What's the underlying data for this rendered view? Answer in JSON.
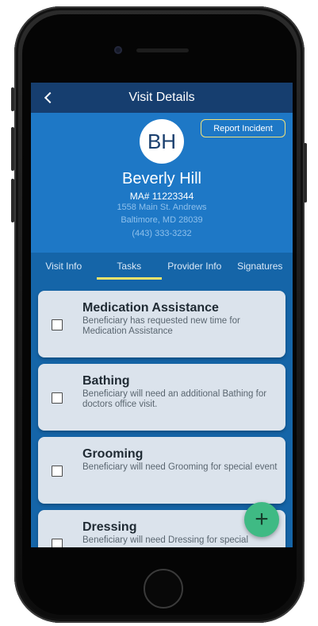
{
  "topbar": {
    "title": "Visit Details",
    "back_icon": "chevron-left-icon"
  },
  "patient": {
    "initials": "BH",
    "name": "Beverly Hill",
    "ma_number": "MA# 11223344",
    "address_line1": "1558 Main St. Andrews",
    "address_line2": "Baltimore, MD 28039",
    "phone": "(443) 333-3232"
  },
  "report_button": {
    "label": "Report Incident"
  },
  "tabs": [
    {
      "label": "Visit Info",
      "active": false
    },
    {
      "label": "Tasks",
      "active": true
    },
    {
      "label": "Provider Info",
      "active": false
    },
    {
      "label": "Signatures",
      "active": false
    }
  ],
  "tasks": [
    {
      "title": "Medication Assistance",
      "description": "Beneficiary has requested new time for Medication Assistance",
      "checked": false
    },
    {
      "title": "Bathing",
      "description": "Beneficiary will need an additional Bathing for doctors office visit.",
      "checked": false
    },
    {
      "title": "Grooming",
      "description": "Beneficiary will need Grooming for special event",
      "checked": false
    },
    {
      "title": "Dressing",
      "description": "Beneficiary will need Dressing for special",
      "checked": false
    }
  ],
  "fab": {
    "label": "+",
    "icon": "plus-icon"
  },
  "colors": {
    "topbar": "#163e6f",
    "header": "#1e78c6",
    "accent_tab": "#f2e36b",
    "fab": "#3fba84",
    "card": "#dbe3ec"
  }
}
